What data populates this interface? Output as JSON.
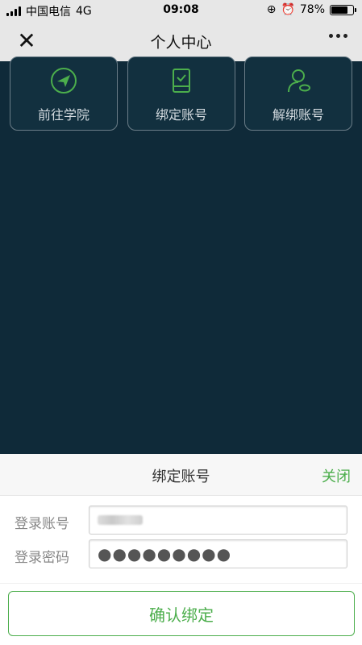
{
  "status_bar": {
    "carrier": "中国电信",
    "network": "4G",
    "time": "09:08",
    "battery": "78%",
    "battery_level": 0.78
  },
  "nav": {
    "title": "个人中心",
    "close_icon": "close-icon",
    "more_icon": "more-icon"
  },
  "menu": {
    "items": [
      {
        "label": "前往学院",
        "icon": "send-icon"
      },
      {
        "label": "绑定账号",
        "icon": "phone-check-icon"
      },
      {
        "label": "解绑账号",
        "icon": "user-unlink-icon"
      }
    ]
  },
  "sheet": {
    "title": "绑定账号",
    "close_label": "关闭",
    "account_label": "登录账号",
    "password_label": "登录密码",
    "password_value": "●●●●●●●●●",
    "confirm_label": "确认绑定"
  },
  "colors": {
    "background": "#0f2a39",
    "accent": "#4cae4c",
    "bar": "#e7e7e7"
  }
}
